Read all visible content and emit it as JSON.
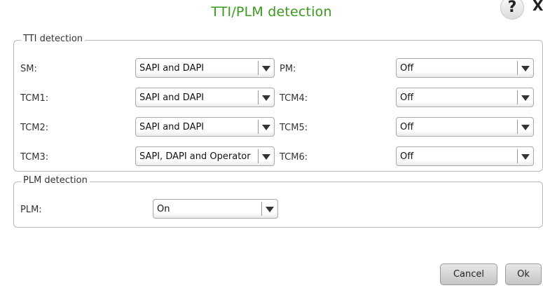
{
  "dialog": {
    "title": "TTI/PLM detection",
    "help_label": "?",
    "close_label": "X"
  },
  "tti": {
    "legend": "TTI detection",
    "rows": [
      {
        "left_label": "SM:",
        "left_value": "SAPI and DAPI",
        "right_label": "PM:",
        "right_value": "Off"
      },
      {
        "left_label": "TCM1:",
        "left_value": "SAPI and DAPI",
        "right_label": "TCM4:",
        "right_value": "Off"
      },
      {
        "left_label": "TCM2:",
        "left_value": "SAPI and DAPI",
        "right_label": "TCM5:",
        "right_value": "Off"
      },
      {
        "left_label": "TCM3:",
        "left_value": "SAPI, DAPI and Operator",
        "right_label": "TCM6:",
        "right_value": "Off"
      }
    ]
  },
  "plm": {
    "legend": "PLM detection",
    "label": "PLM:",
    "value": "On"
  },
  "buttons": {
    "cancel": "Cancel",
    "ok": "Ok"
  }
}
